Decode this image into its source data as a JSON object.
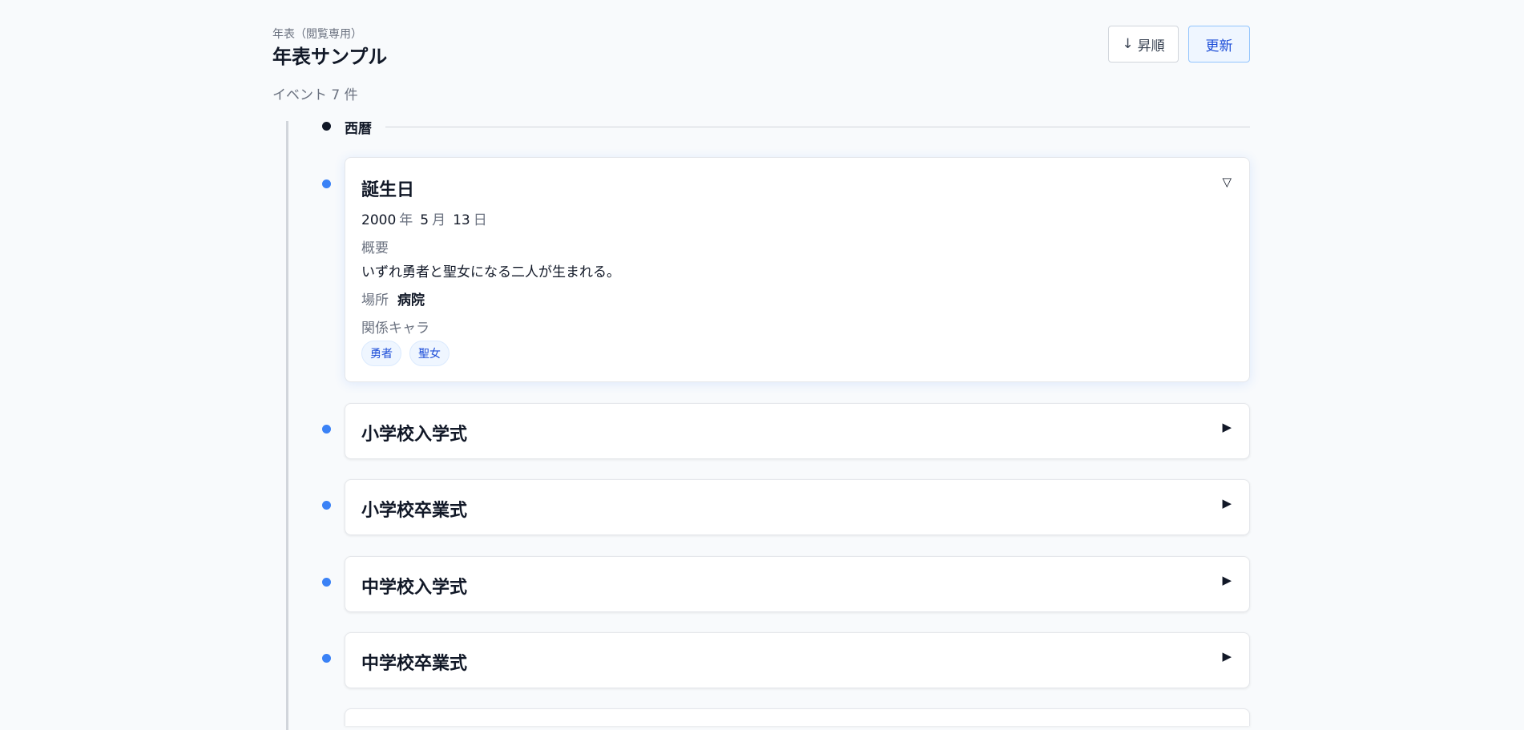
{
  "header": {
    "subtitle": "年表（閲覧専用）",
    "title": "年表サンプル",
    "sort_icon": "↓",
    "sort_label": "昇順",
    "refresh_label": "更新",
    "count_label": "イベント 7 件"
  },
  "era": {
    "label": "西暦"
  },
  "events": [
    {
      "title": "誕生日",
      "expanded": true,
      "toggle_icon": "▽",
      "date": {
        "year": "2000",
        "year_unit": "年",
        "month": "5",
        "month_unit": "月",
        "day": "13",
        "day_unit": "日"
      },
      "summary_label": "概要",
      "summary": "いずれ勇者と聖女になる二人が生まれる。",
      "place_label": "場所",
      "place": "病院",
      "characters_label": "関係キャラ",
      "characters": [
        "勇者",
        "聖女"
      ]
    },
    {
      "title": "小学校入学式",
      "expanded": false,
      "toggle_icon": "▶"
    },
    {
      "title": "小学校卒業式",
      "expanded": false,
      "toggle_icon": "▶"
    },
    {
      "title": "中学校入学式",
      "expanded": false,
      "toggle_icon": "▶"
    },
    {
      "title": "中学校卒業式",
      "expanded": false,
      "toggle_icon": "▶"
    }
  ],
  "colors": {
    "accent": "#3b82f6",
    "tag_text": "#1d4ed8",
    "tag_bg": "#eff6ff"
  }
}
